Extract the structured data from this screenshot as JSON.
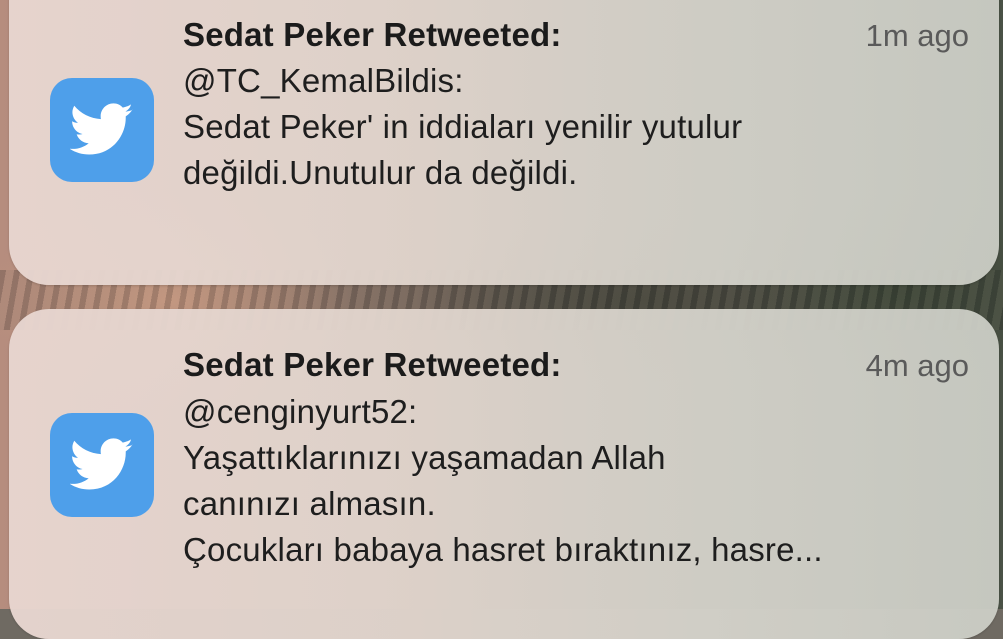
{
  "notifications": [
    {
      "app_icon": "twitter-bird-icon",
      "title": "Sedat Peker Retweeted:",
      "time": "1m ago",
      "lines": [
        "@TC_KemalBildis:",
        "Sedat Peker' in iddiaları yenilir yutulur",
        "değildi.Unutulur da değildi."
      ]
    },
    {
      "app_icon": "twitter-bird-icon",
      "title": "Sedat Peker Retweeted:",
      "time": "4m ago",
      "lines": [
        "@cenginyurt52:",
        "Yaşattıklarınızı yaşamadan Allah",
        "canınızı almasın.",
        "Çocukları babaya hasret bıraktınız, hasre..."
      ]
    }
  ],
  "colors": {
    "twitter_blue": "#4e9fea"
  }
}
